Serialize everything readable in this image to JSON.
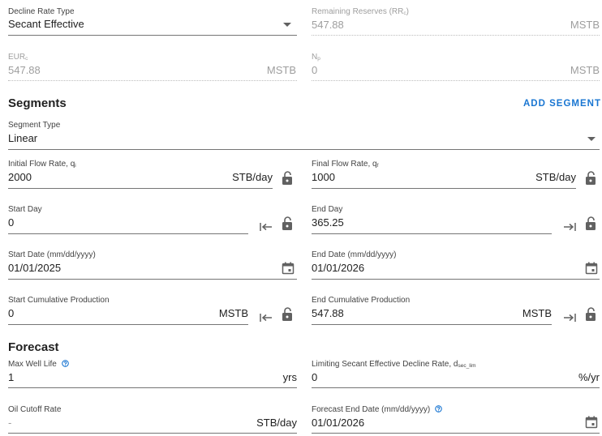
{
  "decline": {
    "type_label": "Decline Rate Type",
    "type_value": "Secant Effective",
    "remaining_label": "Remaining Reserves (RR",
    "remaining_sub": "c",
    "remaining_label_end": ")",
    "remaining_value": "547.88",
    "remaining_unit": "MSTB",
    "eur_label": "EUR",
    "eur_sub": "c",
    "eur_value": "547.88",
    "eur_unit": "MSTB",
    "np_label": "N",
    "np_sub": "p",
    "np_value": "0",
    "np_unit": "MSTB"
  },
  "segments": {
    "title": "Segments",
    "add_label": "ADD SEGMENT",
    "type_label": "Segment Type",
    "type_value": "Linear",
    "initial_label": "Initial Flow Rate, q",
    "initial_sub": "i",
    "initial_value": "2000",
    "initial_unit": "STB/day",
    "final_label": "Final Flow Rate, q",
    "final_sub": "f",
    "final_value": "1000",
    "final_unit": "STB/day",
    "start_day_label": "Start Day",
    "start_day_value": "0",
    "end_day_label": "End Day",
    "end_day_value": "365.25",
    "start_date_label": "Start Date (mm/dd/yyyy)",
    "start_date_value": "01/01/2025",
    "end_date_label": "End Date (mm/dd/yyyy)",
    "end_date_value": "01/01/2026",
    "start_cum_label": "Start Cumulative Production",
    "start_cum_value": "0",
    "start_cum_unit": "MSTB",
    "end_cum_label": "End Cumulative Production",
    "end_cum_value": "547.88",
    "end_cum_unit": "MSTB"
  },
  "forecast": {
    "title": "Forecast",
    "max_life_label": "Max Well Life",
    "max_life_value": "1",
    "max_life_unit": "yrs",
    "limit_label": "Limiting Secant Effective Decline Rate, d",
    "limit_sub": "sec_lim",
    "limit_value": "0",
    "limit_unit": "%/yr",
    "cutoff_label": "Oil Cutoff Rate",
    "cutoff_value": "-",
    "cutoff_unit": "STB/day",
    "end_date_label": "Forecast End Date (mm/dd/yyyy)",
    "end_date_value": "01/01/2026"
  },
  "icons": {
    "dropdown": "caret-down-icon",
    "lock": "lock-open-icon",
    "to_start": "arrow-to-start-icon",
    "to_end": "arrow-to-end-icon",
    "calendar": "calendar-icon",
    "help": "help-circle-icon"
  }
}
